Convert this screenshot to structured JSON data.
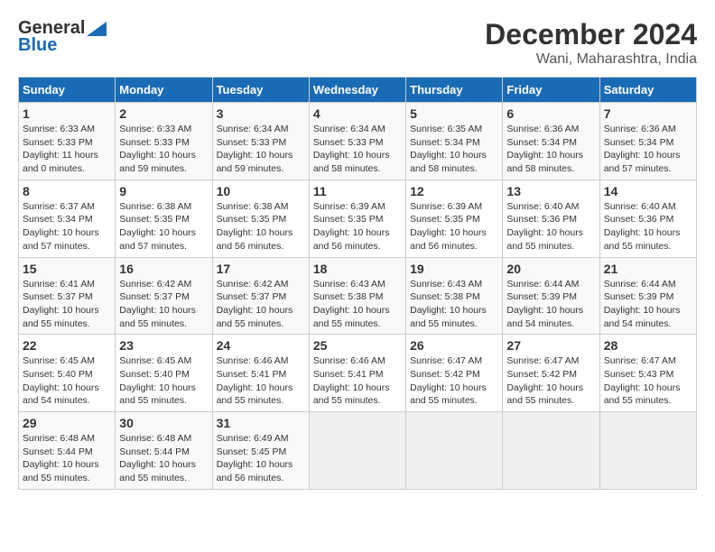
{
  "header": {
    "logo_general": "General",
    "logo_blue": "Blue",
    "title": "December 2024",
    "subtitle": "Wani, Maharashtra, India"
  },
  "columns": [
    "Sunday",
    "Monday",
    "Tuesday",
    "Wednesday",
    "Thursday",
    "Friday",
    "Saturday"
  ],
  "weeks": [
    [
      {
        "day": "1",
        "sunrise": "Sunrise: 6:33 AM",
        "sunset": "Sunset: 5:33 PM",
        "daylight": "Daylight: 11 hours and 0 minutes."
      },
      {
        "day": "2",
        "sunrise": "Sunrise: 6:33 AM",
        "sunset": "Sunset: 5:33 PM",
        "daylight": "Daylight: 10 hours and 59 minutes."
      },
      {
        "day": "3",
        "sunrise": "Sunrise: 6:34 AM",
        "sunset": "Sunset: 5:33 PM",
        "daylight": "Daylight: 10 hours and 59 minutes."
      },
      {
        "day": "4",
        "sunrise": "Sunrise: 6:34 AM",
        "sunset": "Sunset: 5:33 PM",
        "daylight": "Daylight: 10 hours and 58 minutes."
      },
      {
        "day": "5",
        "sunrise": "Sunrise: 6:35 AM",
        "sunset": "Sunset: 5:34 PM",
        "daylight": "Daylight: 10 hours and 58 minutes."
      },
      {
        "day": "6",
        "sunrise": "Sunrise: 6:36 AM",
        "sunset": "Sunset: 5:34 PM",
        "daylight": "Daylight: 10 hours and 58 minutes."
      },
      {
        "day": "7",
        "sunrise": "Sunrise: 6:36 AM",
        "sunset": "Sunset: 5:34 PM",
        "daylight": "Daylight: 10 hours and 57 minutes."
      }
    ],
    [
      {
        "day": "8",
        "sunrise": "Sunrise: 6:37 AM",
        "sunset": "Sunset: 5:34 PM",
        "daylight": "Daylight: 10 hours and 57 minutes."
      },
      {
        "day": "9",
        "sunrise": "Sunrise: 6:38 AM",
        "sunset": "Sunset: 5:35 PM",
        "daylight": "Daylight: 10 hours and 57 minutes."
      },
      {
        "day": "10",
        "sunrise": "Sunrise: 6:38 AM",
        "sunset": "Sunset: 5:35 PM",
        "daylight": "Daylight: 10 hours and 56 minutes."
      },
      {
        "day": "11",
        "sunrise": "Sunrise: 6:39 AM",
        "sunset": "Sunset: 5:35 PM",
        "daylight": "Daylight: 10 hours and 56 minutes."
      },
      {
        "day": "12",
        "sunrise": "Sunrise: 6:39 AM",
        "sunset": "Sunset: 5:35 PM",
        "daylight": "Daylight: 10 hours and 56 minutes."
      },
      {
        "day": "13",
        "sunrise": "Sunrise: 6:40 AM",
        "sunset": "Sunset: 5:36 PM",
        "daylight": "Daylight: 10 hours and 55 minutes."
      },
      {
        "day": "14",
        "sunrise": "Sunrise: 6:40 AM",
        "sunset": "Sunset: 5:36 PM",
        "daylight": "Daylight: 10 hours and 55 minutes."
      }
    ],
    [
      {
        "day": "15",
        "sunrise": "Sunrise: 6:41 AM",
        "sunset": "Sunset: 5:37 PM",
        "daylight": "Daylight: 10 hours and 55 minutes."
      },
      {
        "day": "16",
        "sunrise": "Sunrise: 6:42 AM",
        "sunset": "Sunset: 5:37 PM",
        "daylight": "Daylight: 10 hours and 55 minutes."
      },
      {
        "day": "17",
        "sunrise": "Sunrise: 6:42 AM",
        "sunset": "Sunset: 5:37 PM",
        "daylight": "Daylight: 10 hours and 55 minutes."
      },
      {
        "day": "18",
        "sunrise": "Sunrise: 6:43 AM",
        "sunset": "Sunset: 5:38 PM",
        "daylight": "Daylight: 10 hours and 55 minutes."
      },
      {
        "day": "19",
        "sunrise": "Sunrise: 6:43 AM",
        "sunset": "Sunset: 5:38 PM",
        "daylight": "Daylight: 10 hours and 55 minutes."
      },
      {
        "day": "20",
        "sunrise": "Sunrise: 6:44 AM",
        "sunset": "Sunset: 5:39 PM",
        "daylight": "Daylight: 10 hours and 54 minutes."
      },
      {
        "day": "21",
        "sunrise": "Sunrise: 6:44 AM",
        "sunset": "Sunset: 5:39 PM",
        "daylight": "Daylight: 10 hours and 54 minutes."
      }
    ],
    [
      {
        "day": "22",
        "sunrise": "Sunrise: 6:45 AM",
        "sunset": "Sunset: 5:40 PM",
        "daylight": "Daylight: 10 hours and 54 minutes."
      },
      {
        "day": "23",
        "sunrise": "Sunrise: 6:45 AM",
        "sunset": "Sunset: 5:40 PM",
        "daylight": "Daylight: 10 hours and 55 minutes."
      },
      {
        "day": "24",
        "sunrise": "Sunrise: 6:46 AM",
        "sunset": "Sunset: 5:41 PM",
        "daylight": "Daylight: 10 hours and 55 minutes."
      },
      {
        "day": "25",
        "sunrise": "Sunrise: 6:46 AM",
        "sunset": "Sunset: 5:41 PM",
        "daylight": "Daylight: 10 hours and 55 minutes."
      },
      {
        "day": "26",
        "sunrise": "Sunrise: 6:47 AM",
        "sunset": "Sunset: 5:42 PM",
        "daylight": "Daylight: 10 hours and 55 minutes."
      },
      {
        "day": "27",
        "sunrise": "Sunrise: 6:47 AM",
        "sunset": "Sunset: 5:42 PM",
        "daylight": "Daylight: 10 hours and 55 minutes."
      },
      {
        "day": "28",
        "sunrise": "Sunrise: 6:47 AM",
        "sunset": "Sunset: 5:43 PM",
        "daylight": "Daylight: 10 hours and 55 minutes."
      }
    ],
    [
      {
        "day": "29",
        "sunrise": "Sunrise: 6:48 AM",
        "sunset": "Sunset: 5:44 PM",
        "daylight": "Daylight: 10 hours and 55 minutes."
      },
      {
        "day": "30",
        "sunrise": "Sunrise: 6:48 AM",
        "sunset": "Sunset: 5:44 PM",
        "daylight": "Daylight: 10 hours and 55 minutes."
      },
      {
        "day": "31",
        "sunrise": "Sunrise: 6:49 AM",
        "sunset": "Sunset: 5:45 PM",
        "daylight": "Daylight: 10 hours and 56 minutes."
      },
      null,
      null,
      null,
      null
    ]
  ]
}
